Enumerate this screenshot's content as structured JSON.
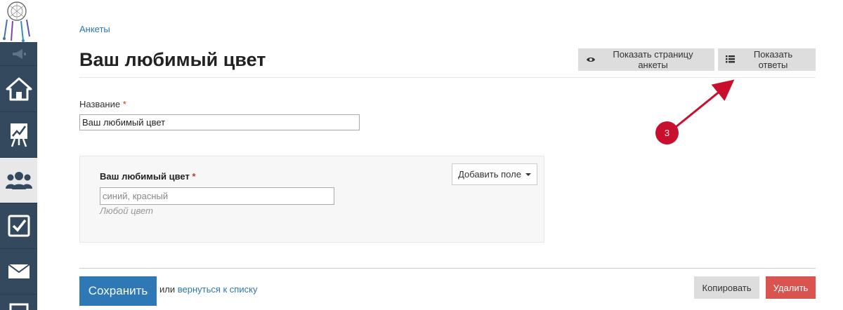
{
  "breadcrumb": "Анкеты",
  "page_title": "Ваш любимый цвет",
  "header_buttons": {
    "show_page": "Показать страницу анкеты",
    "show_answers": "Показать ответы"
  },
  "name_field": {
    "label": "Название",
    "required_mark": "*",
    "value": "Ваш любимый цвет"
  },
  "question_panel": {
    "label": "Ваш любимый цвет",
    "required_mark": "*",
    "placeholder": "синий, красный",
    "hint": "Любой цвет",
    "add_field_label": "Добавить поле"
  },
  "footer": {
    "save_label": "Сохранить",
    "or_text": "или",
    "back_link": "вернуться к списку",
    "copy_label": "Копировать",
    "delete_label": "Удалить"
  },
  "annotation": {
    "step_number": "3",
    "color": "#c8102e"
  },
  "sidebar": {
    "items": [
      {
        "icon": "megaphone-icon"
      },
      {
        "icon": "home-icon"
      },
      {
        "icon": "chart-board-icon"
      },
      {
        "icon": "users-icon",
        "active": true
      },
      {
        "icon": "checkbox-icon"
      },
      {
        "icon": "envelope-icon"
      }
    ]
  },
  "colors": {
    "sidebar": "#34495e",
    "primary": "#2e78b6",
    "danger": "#d9534f",
    "link": "#2a7ab0"
  }
}
